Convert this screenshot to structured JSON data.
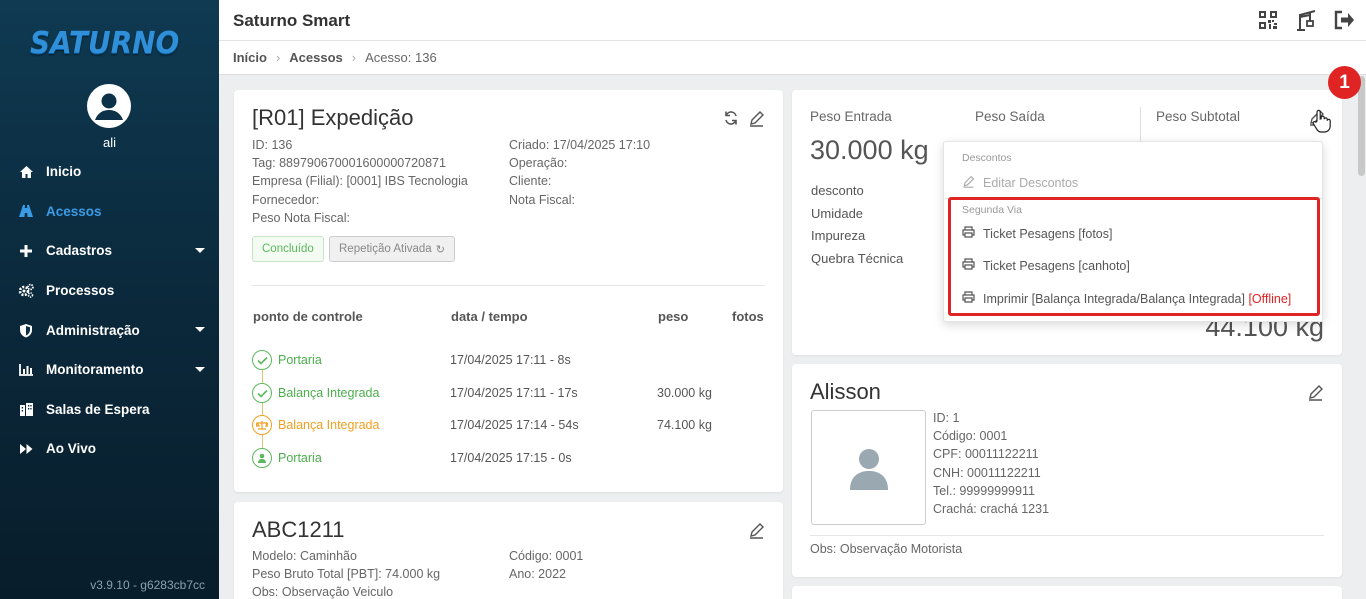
{
  "sidebar": {
    "logo": "SATURNO",
    "username": "ali",
    "version": "v3.9.10 - g6283cb7cc",
    "items": [
      {
        "label": "Inicio",
        "icon": "home-icon"
      },
      {
        "label": "Acessos",
        "icon": "road-icon",
        "active": true
      },
      {
        "label": "Cadastros",
        "icon": "plus-icon",
        "caret": true
      },
      {
        "label": "Processos",
        "icon": "gears-icon"
      },
      {
        "label": "Administração",
        "icon": "shield-icon",
        "caret": true
      },
      {
        "label": "Monitoramento",
        "icon": "chart-icon",
        "caret": true
      },
      {
        "label": "Salas de Espera",
        "icon": "building-icon"
      },
      {
        "label": "Ao Vivo",
        "icon": "fast-forward-icon"
      }
    ]
  },
  "header": {
    "title": "Saturno Smart",
    "icons": [
      "qrcode-icon",
      "crane-icon",
      "logout-icon"
    ]
  },
  "breadcrumb": {
    "home": "Início",
    "section": "Acessos",
    "current": "Acesso: 136"
  },
  "access_card": {
    "title": "[R01] Expedição",
    "left": [
      "ID: 136",
      "Tag: 889790670001600000720871",
      "Empresa (Filial): [0001] IBS Tecnologia",
      "Fornecedor:",
      "Peso Nota Fiscal:"
    ],
    "right": [
      "Criado: 17/04/2025 17:10",
      "Operação:",
      "Cliente:",
      "Nota Fiscal:"
    ],
    "status_badge": "Concluído",
    "repeat_badge": "Repetição Ativada",
    "table": {
      "headers": [
        "ponto de controle",
        "data / tempo",
        "peso",
        "fotos"
      ],
      "rows": [
        {
          "point": "Portaria",
          "time": "17/04/2025 17:11 - 8s",
          "weight": "",
          "color": "#4cae4c"
        },
        {
          "point": "Balança Integrada",
          "time": "17/04/2025 17:11 - 17s",
          "weight": "30.000 kg",
          "color": "#4cae4c"
        },
        {
          "point": "Balança Integrada",
          "time": "17/04/2025 17:14 - 54s",
          "weight": "74.100 kg",
          "color": "#f0a020"
        },
        {
          "point": "Portaria",
          "time": "17/04/2025 17:15 - 0s",
          "weight": "",
          "color": "#4cae4c"
        }
      ]
    }
  },
  "vehicle_card": {
    "title": "ABC1211",
    "left": [
      "Modelo: Caminhão",
      "Peso Bruto Total [PBT]: 74.000 kg",
      "Obs: Observação Veiculo"
    ],
    "right": [
      "Código: 0001",
      "Ano: 2022"
    ]
  },
  "weight_card": {
    "entrada_label": "Peso Entrada",
    "saida_label": "Peso Saída",
    "subtotal_label": "Peso Subtotal",
    "entrada_value": "30.000 kg",
    "rows": [
      "desconto",
      "Umidade",
      "Impureza",
      "Quebra Técnica"
    ],
    "total_value": "44.100 kg"
  },
  "dropdown": {
    "discount_header": "Descontos",
    "edit_discounts": "Editar Descontos",
    "second_copy_header": "Segunda Via",
    "ticket_photos": "Ticket Pesagens [fotos]",
    "ticket_stub": "Ticket Pesagens [canhoto]",
    "print_label": "Imprimir [Balança Integrada/Balança Integrada]",
    "offline_label": "[Offline]"
  },
  "annotation_marker": "1",
  "driver_card": {
    "name": "Alisson",
    "info": [
      "ID: 1",
      "Código: 0001",
      "CPF: 00011122211",
      "CNH: 00011122211",
      "Tel.: 99999999911",
      "Crachá: crachá 1231"
    ],
    "obs": "Obs: Observação Motorista"
  },
  "colors": {
    "accent": "#3a9be6",
    "success": "#4cae4c",
    "warning": "#f0a020",
    "danger": "#e02424"
  }
}
